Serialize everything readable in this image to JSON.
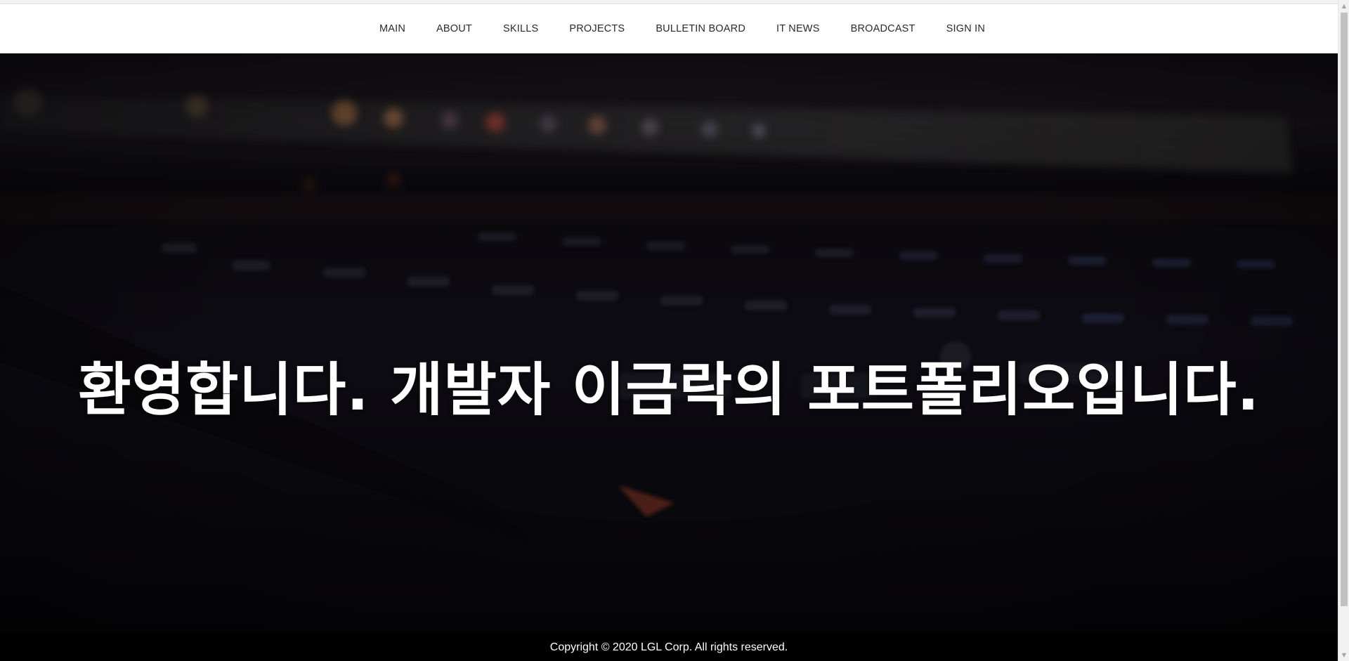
{
  "nav": {
    "items": [
      {
        "label": "MAIN"
      },
      {
        "label": "ABOUT"
      },
      {
        "label": "SKILLS"
      },
      {
        "label": "PROJECTS"
      },
      {
        "label": "BULLETIN BOARD"
      },
      {
        "label": "IT NEWS"
      },
      {
        "label": "BROADCAST"
      },
      {
        "label": "SIGN IN"
      }
    ]
  },
  "hero": {
    "title": "환영합니다. 개발자 이금락의 포트폴리오입니다.",
    "background_image": "laptop-keyboard-dark-photo"
  },
  "footer": {
    "copyright": "Copyright © 2020 LGL Corp. All rights reserved."
  },
  "colors": {
    "nav_bg": "#ffffff",
    "nav_text": "#2a2a2a",
    "hero_overlay": "#0b0a0f",
    "hero_text": "#ffffff",
    "footer_bg": "#000000",
    "footer_text": "#ffffff"
  }
}
